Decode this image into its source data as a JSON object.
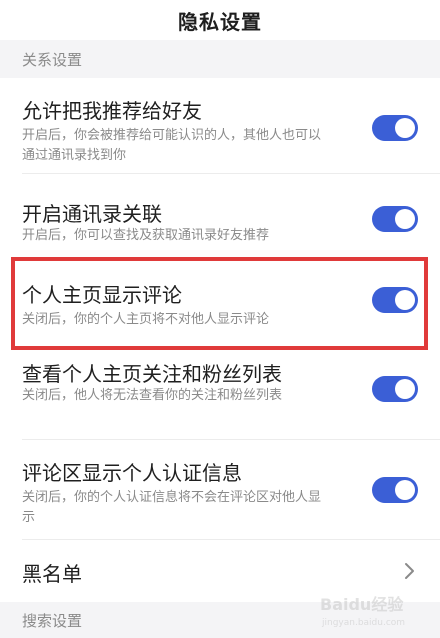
{
  "header": {
    "title": "隐私设置"
  },
  "sections": {
    "relation": "关系设置",
    "search": "搜索设置"
  },
  "settings": [
    {
      "title": "允许把我推荐给好友",
      "desc": "开启后，你会被推荐给可能认识的人，其他人也可以通过通讯录找到你",
      "enabled": true
    },
    {
      "title": "开启通讯录关联",
      "desc": "开启后，你可以查找及获取通讯录好友推荐",
      "enabled": true
    },
    {
      "title": "个人主页显示评论",
      "desc": "关闭后，你的个人主页将不对他人显示评论",
      "enabled": true
    },
    {
      "title": "查看个人主页关注和粉丝列表",
      "desc": "关闭后，他人将无法查看你的关注和粉丝列表",
      "enabled": true
    },
    {
      "title": "评论区显示个人认证信息",
      "desc": "关闭后，你的个人认证信息将不会在评论区对他人显示",
      "enabled": true
    }
  ],
  "blacklist": {
    "label": "黑名单"
  },
  "watermark": {
    "brand": "Baidu经验",
    "url": "jingyan.baidu.com"
  },
  "colors": {
    "toggle_on": "#3b5fd6",
    "highlight": "#e03a3a",
    "section_bg": "#f4f4f6"
  }
}
